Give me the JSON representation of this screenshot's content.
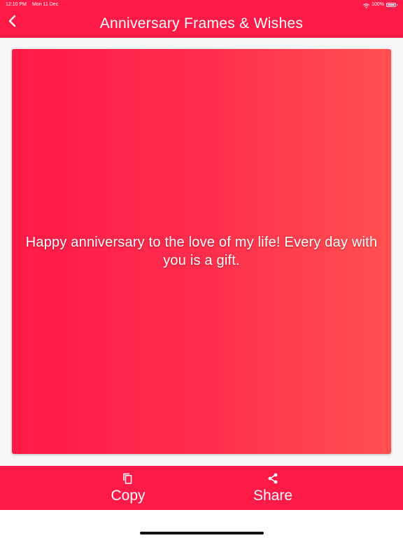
{
  "status_bar": {
    "time": "12:10 PM",
    "date": "Mon 11 Dec",
    "battery": "100%",
    "icons": [
      "wifi-icon",
      "battery-icon"
    ]
  },
  "header": {
    "title": "Anniversary Frames & Wishes",
    "back_icon": "chevron-left-icon"
  },
  "card": {
    "message": "Happy anniversary to the love of my life! Every day with you is a gift.",
    "gradient_start": "#ff1a47",
    "gradient_end": "#ff5050"
  },
  "actions": {
    "copy": {
      "label": "Copy",
      "icon": "copy-icon"
    },
    "share": {
      "label": "Share",
      "icon": "share-icon"
    }
  },
  "colors": {
    "primary": "#ff1a47",
    "background": "#f7f7f7",
    "text_on_primary": "#ffffff"
  }
}
